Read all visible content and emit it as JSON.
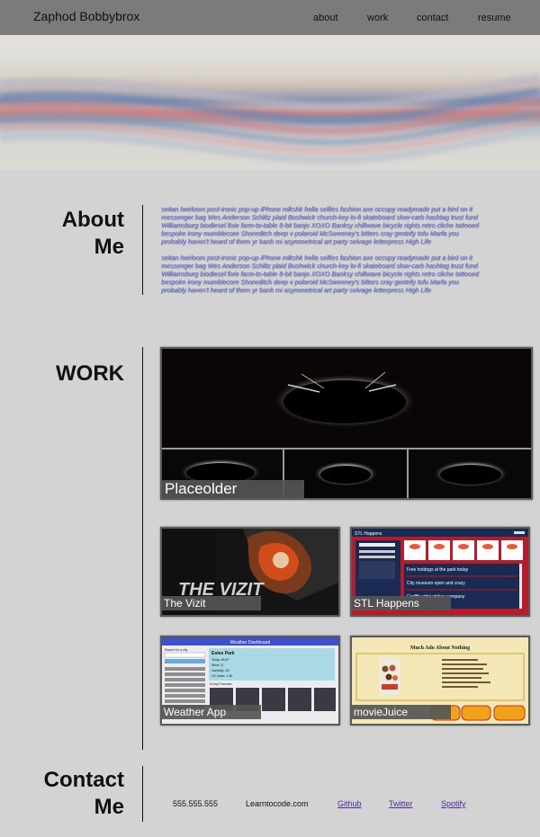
{
  "nav": {
    "brand": "Zaphod Bobbybrox",
    "links": [
      "about",
      "work",
      "contact",
      "resume"
    ]
  },
  "about": {
    "title_line1": "About",
    "title_line2": "Me",
    "paragraphs": [
      "seitan heirloom post-ironic pop-up iPhone mlkshk hella selfies fashion axe occupy readymade put a bird on it messenger bag Wes Anderson Schlitz plaid Bushwick church-key lo-fi skateboard slow-carb hashtag trust fund Williamsburg biodiesel fixie farm-to-table 8-bit banjo XOXO Banksy chillwave bicycle rights retro cliche tattooed bespoke irony mumblecore Shoreditch deep v polaroid McSweeney's bitters cray gentrify tofu Marfa you probably haven't heard of them yr banh mi asymmetrical art party selvage letterpress High Life",
      "seitan heirloom post-ironic pop-up iPhone mlkshk hella selfies fashion axe occupy readymade put a bird on it messenger bag Wes Anderson Schlitz plaid Bushwick church-key lo-fi skateboard slow-carb hashtag trust fund Williamsburg biodiesel fixie farm-to-table 8-bit banjo XOXO Banksy chillwave bicycle rights retro cliche tattooed bespoke irony mumblecore Shoreditch deep v polaroid McSweeney's bitters cray gentrify tofu Marfa you probably haven't heard of them yr banh mi asymmetrical art party selvage letterpress High Life"
    ]
  },
  "work": {
    "title": "WORK",
    "featured": {
      "label": "Placeolder"
    },
    "projects": [
      {
        "label": "The Vizit",
        "art_text": "THE VIZIT"
      },
      {
        "label": "STL Happens",
        "app_title": "STL Happens",
        "feed": [
          "Free hotdogs at the park today",
          "City museum open and crazy",
          "Graffiti artist strikes company"
        ]
      },
      {
        "label": "Weather App",
        "app_title": "Weather Dashboard",
        "search_label": "Search for a city:",
        "city": "Estes Park",
        "stats": [
          "Temp: 48.4F",
          "Wind: 11",
          "Humidity: 18",
          "UV Index: 1.46"
        ],
        "forecast_title": "5-Day Forecast:"
      },
      {
        "label": "movieJuice",
        "app_title": "Much Ado About Nothing"
      }
    ]
  },
  "contact": {
    "title_line1": "Contact",
    "title_line2": "Me",
    "phone": "555.555.555",
    "website": "Learntocode.com",
    "links": [
      "Github",
      "Twitter",
      "Spotify"
    ]
  },
  "colors": {
    "nav_bg": "#7b7b7b",
    "page_bg": "#d3d3d3",
    "about_text": "#7a80d8",
    "link": "#4b2aa0",
    "label_bg": "#555555",
    "stl_red": "#b71c2c",
    "stl_navy": "#1b2a52",
    "weather_header": "#3f4fc7",
    "movie_bg": "#f4e7b6",
    "movie_button": "#f2a21a"
  }
}
